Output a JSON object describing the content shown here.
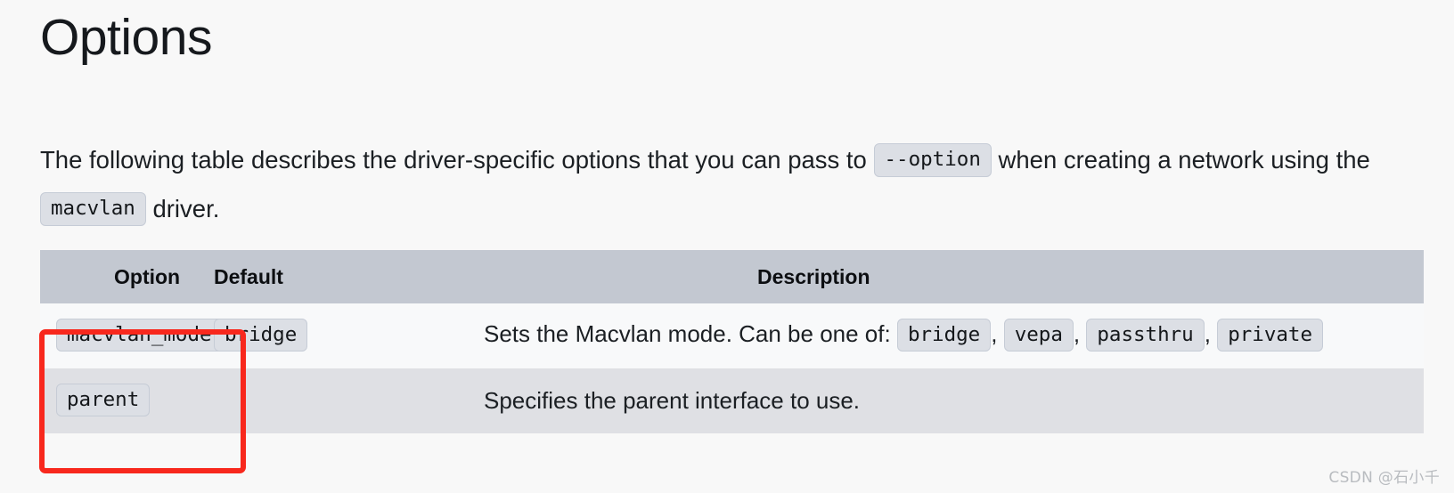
{
  "heading": "Options",
  "intro": {
    "part1": "The following table describes the driver-specific options that you can pass to",
    "code1": "--option",
    "part2": "when creating a network using the",
    "code2": "macvlan",
    "part3": "driver."
  },
  "table": {
    "headers": {
      "option": "Option",
      "default": "Default",
      "description": "Description"
    },
    "rows": [
      {
        "option": "macvlan_mode",
        "default": "bridge",
        "description_prefix": "Sets the Macvlan mode. Can be one of:",
        "description_codes": [
          "bridge",
          "vepa",
          "passthru",
          "private"
        ],
        "description_separator": ","
      },
      {
        "option": "parent",
        "default": "",
        "description_prefix": "Specifies the parent interface to use.",
        "description_codes": [],
        "description_separator": ","
      }
    ]
  },
  "annotation": {
    "color": "#f8281d",
    "label": "highlight-option-column"
  },
  "watermark": "CSDN @石小千",
  "colors": {
    "page_background": "#f8f8f8",
    "table_header_background": "#c3c8d1",
    "row_odd_background": "#f8f9fa",
    "row_even_background": "#dfe0e4",
    "code_chip_background": "#dcdfe5",
    "code_chip_border": "#c6ccd6",
    "text": "#1b1f23",
    "watermark": "#b9bcc0"
  }
}
